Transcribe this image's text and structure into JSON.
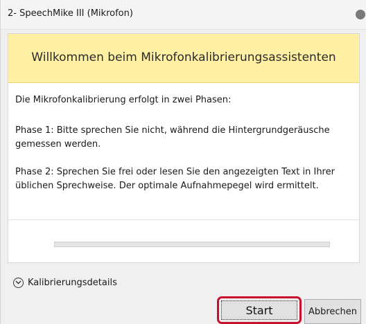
{
  "window": {
    "title": "2- SpeechMike III (Mikrofon)"
  },
  "banner": {
    "heading": "Willkommen beim Mikrofonkalibrierungsassistenten"
  },
  "content": {
    "intro": "Die Mikrofonkalibrierung erfolgt in zwei Phasen:",
    "phase1": "Phase 1: Bitte sprechen Sie nicht, während die Hintergrundgeräusche gemessen werden.",
    "phase2": "Phase 2: Sprechen Sie frei oder lesen Sie den angezeigten Text in Ihrer üblichen Sprechweise. Der optimale Aufnahmepegel wird ermittelt."
  },
  "progress": {
    "value": 0
  },
  "details": {
    "label": "Kalibrierungsdetails",
    "icon": "chevron-down-circle-icon"
  },
  "buttons": {
    "start_label": "Start",
    "cancel_label": "Abbrechen"
  },
  "colors": {
    "banner_background": "#fff0a3",
    "highlight_border": "#c8102e"
  }
}
